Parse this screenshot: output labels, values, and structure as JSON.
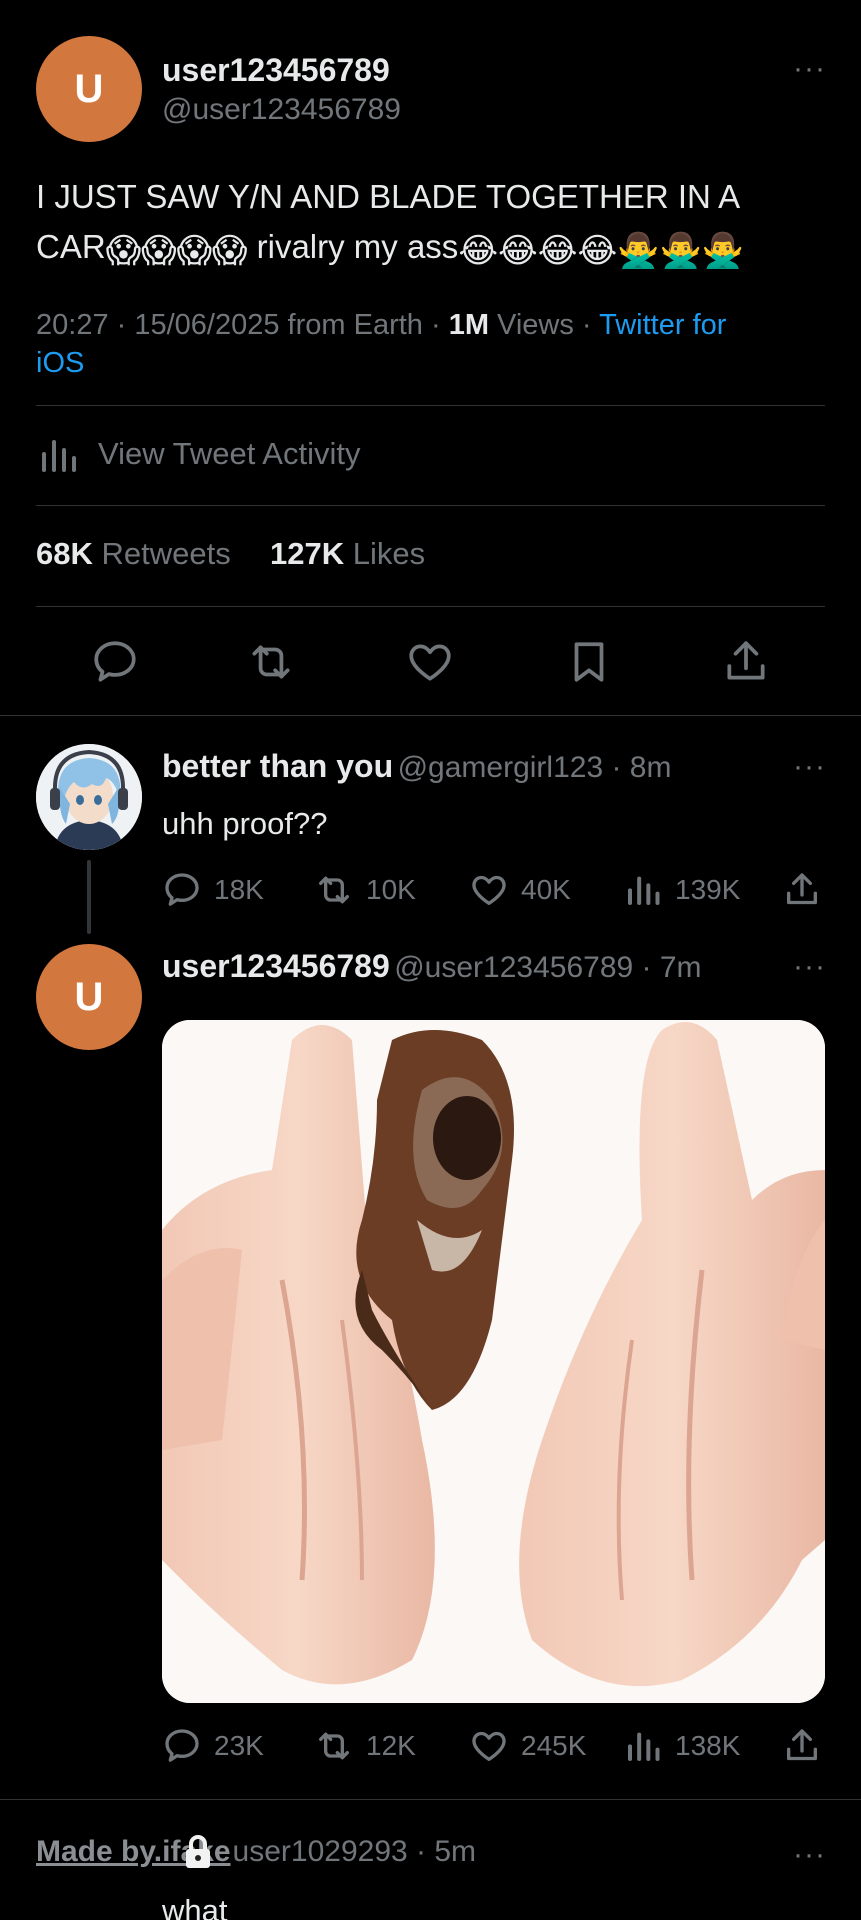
{
  "main_tweet": {
    "avatar_letter": "U",
    "display_name": "user123456789",
    "handle": "@user123456789",
    "text_line1": "I JUST SAW Y/N AND BLADE TOGETHER IN A",
    "text_line2_prefix": "CAR",
    "emoji_scream": "😱😱😱😱",
    "text_line2_middle": " rivalry my ass",
    "emoji_joy": "😂😂😂😂",
    "emoji_nope": "🙅‍♂️🙅‍♂️🙅‍♂️",
    "meta_time": "20:27 · 15/06/2025 from Earth · ",
    "views_count": "1M",
    "views_label": " Views · ",
    "source_part1": "Twitter for",
    "source_part2": "iOS",
    "activity_label": "View Tweet Activity",
    "retweets_count": "68K",
    "retweets_label": "Retweets",
    "likes_count": "127K",
    "likes_label": "Likes",
    "more": "···"
  },
  "reply1": {
    "display_name": "better than you",
    "handle_time": "@gamergirl123 · 8m",
    "text": "uhh proof??",
    "replies": "18K",
    "retweets": "10K",
    "likes": "40K",
    "views": "139K",
    "more": "···"
  },
  "reply2": {
    "avatar_letter": "U",
    "display_name": "user123456789",
    "handle_time": "@user123456789 · 7m",
    "replies": "23K",
    "retweets": "12K",
    "likes": "245K",
    "views": "138K",
    "more": "···"
  },
  "reply3": {
    "watermark": "Made by.ifake",
    "handle_time": "user1029293 · 5m",
    "text": "what",
    "more": "···"
  },
  "colors": {
    "accent": "#1d9bf0",
    "avatar": "#d2773e",
    "muted": "#71767b",
    "divider": "#2f3336"
  }
}
